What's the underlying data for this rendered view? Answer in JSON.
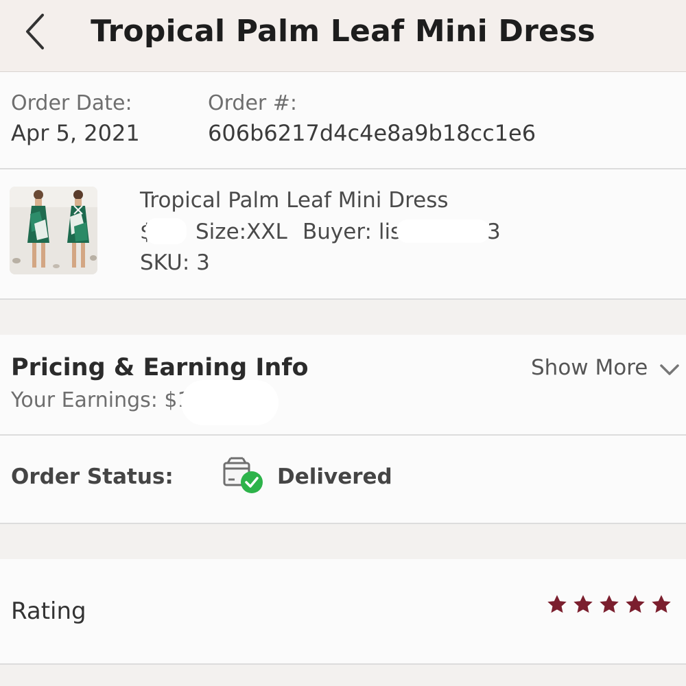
{
  "header": {
    "title": "Tropical Palm Leaf Mini Dress",
    "back_icon": "chevron-left-icon"
  },
  "order": {
    "date_label": "Order Date:",
    "date_value": "Apr 5, 2021",
    "number_label": "Order #:",
    "number_value": "606b6217d4c4e8a9b18cc1e6"
  },
  "product": {
    "name": "Tropical Palm Leaf Mini Dress",
    "price_partial": "$1",
    "size": "Size:XXL",
    "buyer_prefix": "Buyer: lis",
    "buyer_suffix": "3",
    "sku": "SKU: 3"
  },
  "pricing": {
    "title": "Pricing & Earning Info",
    "earnings_label": "Your Earnings: $1",
    "show_more": "Show More"
  },
  "status": {
    "label": "Order Status:",
    "value": "Delivered",
    "icon": "delivered-box-icon"
  },
  "rating": {
    "label": "Rating",
    "stars": 5,
    "max_stars": 5,
    "star_color": "#7b1f2e"
  },
  "colors": {
    "accent": "#7b1f2e",
    "success": "#2db34a"
  }
}
